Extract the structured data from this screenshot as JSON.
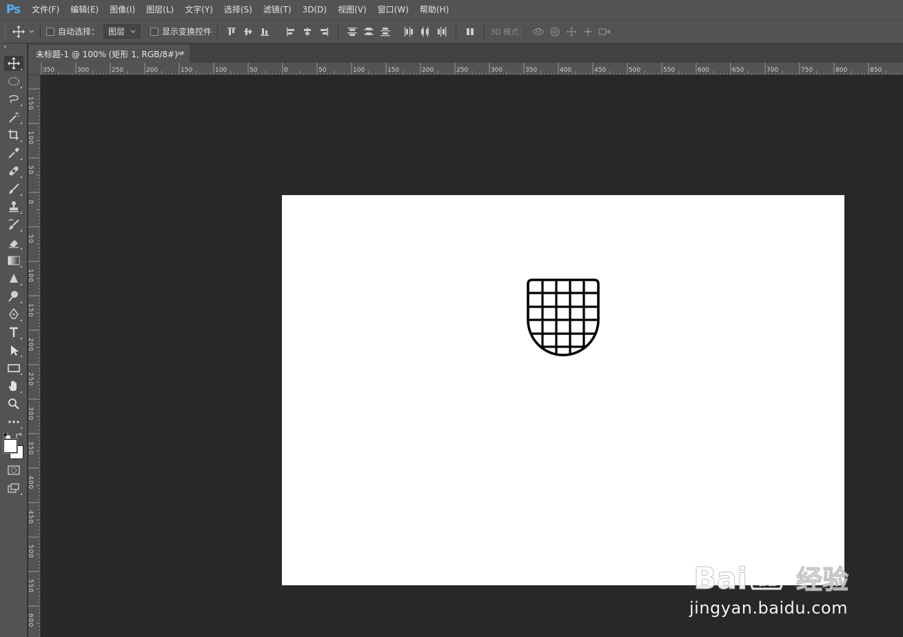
{
  "app": {
    "logo_text": "Ps",
    "accent_color": "#4fb3f5"
  },
  "menu": {
    "items": [
      "文件(F)",
      "编辑(E)",
      "图像(I)",
      "图层(L)",
      "文字(Y)",
      "选择(S)",
      "滤镜(T)",
      "3D(D)",
      "视图(V)",
      "窗口(W)",
      "帮助(H)"
    ]
  },
  "options": {
    "auto_select_label": "自动选择：",
    "auto_select_checked": false,
    "target_select_value": "图层",
    "show_transform_label": "显示变换控件",
    "show_transform_checked": false,
    "mode3d_label": "3D 模式："
  },
  "toolbar": {
    "header": "»",
    "tools": [
      "move-tool-icon",
      "marquee-tool-icon",
      "lasso-tool-icon",
      "magic-wand-tool-icon",
      "crop-tool-icon",
      "eyedropper-tool-icon",
      "healing-brush-tool-icon",
      "brush-tool-icon",
      "clone-stamp-tool-icon",
      "history-brush-tool-icon",
      "eraser-tool-icon",
      "gradient-tool-icon",
      "blur-tool-icon",
      "dodge-tool-icon",
      "pen-tool-icon",
      "type-tool-icon",
      "path-selection-tool-icon",
      "rectangle-tool-icon",
      "hand-tool-icon",
      "zoom-tool-icon",
      "more-tools-icon"
    ],
    "foreground_color": "#ffffff",
    "background_color": "#ffffff"
  },
  "document": {
    "tab_title": "未标题-1 @ 100% (矩形 1, RGB/8#) *",
    "close_glyph": "×",
    "canvas_color": "#ffffff"
  },
  "rulers": {
    "horizontal_labels": [
      "350",
      "300",
      "250",
      "200",
      "150",
      "100",
      "50",
      "0",
      "50",
      "100",
      "150",
      "200",
      "250",
      "300",
      "350",
      "400",
      "450",
      "500",
      "550",
      "600",
      "650",
      "700",
      "750",
      "800",
      "850"
    ],
    "vertical_labels": [
      "150",
      "100",
      "50",
      "0",
      "50",
      "100",
      "150",
      "200",
      "250",
      "300",
      "350",
      "400",
      "450",
      "500",
      "550",
      "600"
    ]
  },
  "watermark": {
    "brand": "Bai du 经验",
    "url": "jingyan.baidu.com"
  }
}
